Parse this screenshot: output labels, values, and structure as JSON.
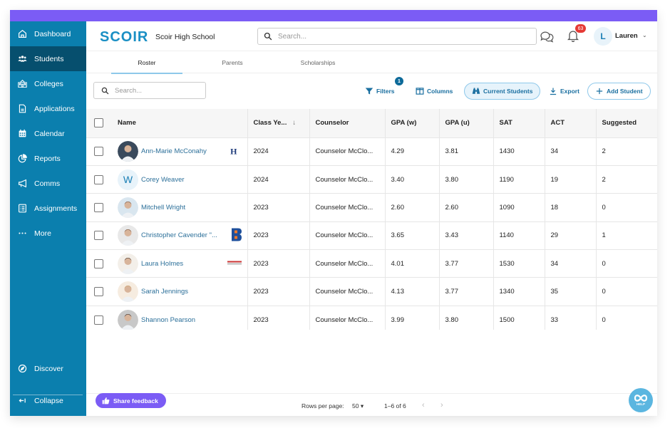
{
  "app": {
    "logo": "SCOIR",
    "school": "Scoir High School"
  },
  "colors": {
    "accent": "#7b5cf5",
    "sidebar": "#0b7fae",
    "sidebar_active": "#064f6e",
    "link": "#2b6f99",
    "notification": "#e53935"
  },
  "header": {
    "search_placeholder": "Search...",
    "notifications_count": "63",
    "user_initial": "L",
    "user_name": "Lauren",
    "user_chevron": "⌄"
  },
  "sidebar": {
    "items": [
      {
        "label": "Dashboard",
        "icon": "home-icon"
      },
      {
        "label": "Students",
        "icon": "users-icon",
        "active": true
      },
      {
        "label": "Colleges",
        "icon": "college-icon"
      },
      {
        "label": "Applications",
        "icon": "document-icon"
      },
      {
        "label": "Calendar",
        "icon": "calendar-icon"
      },
      {
        "label": "Reports",
        "icon": "pie-chart-icon"
      },
      {
        "label": "Comms",
        "icon": "megaphone-icon"
      },
      {
        "label": "Assignments",
        "icon": "list-icon"
      },
      {
        "label": "More",
        "icon": "more-icon"
      }
    ],
    "discover": "Discover",
    "collapse": "Collapse"
  },
  "tabs": [
    {
      "label": "Roster",
      "active": true
    },
    {
      "label": "Parents"
    },
    {
      "label": "Scholarships"
    }
  ],
  "toolbar": {
    "search_placeholder": "Search...",
    "filters": "Filters",
    "filters_count": "1",
    "columns": "Columns",
    "current_students": "Current Students",
    "export": "Export",
    "add_student": "Add Student"
  },
  "table": {
    "columns": [
      "Name",
      "Class Ye...",
      "Counselor",
      "GPA (w)",
      "GPA (u)",
      "SAT",
      "ACT",
      "Suggested"
    ],
    "sort_indicator": "↓",
    "rows": [
      {
        "name": "Ann-Marie McConahy",
        "avatar": "photo",
        "college_logo": "H",
        "class_year": "2024",
        "counselor": "Counselor McClo...",
        "gpa_w": "4.29",
        "gpa_u": "3.81",
        "sat": "1430",
        "act": "34",
        "suggested": "2"
      },
      {
        "name": "Corey Weaver",
        "avatar": "initial",
        "initial": "W",
        "college_logo": "",
        "class_year": "2024",
        "counselor": "Counselor McClo...",
        "gpa_w": "3.40",
        "gpa_u": "3.80",
        "sat": "1190",
        "act": "19",
        "suggested": "2"
      },
      {
        "name": "Mitchell Wright",
        "avatar": "photo",
        "college_logo": "",
        "class_year": "2023",
        "counselor": "Counselor McClo...",
        "gpa_w": "2.60",
        "gpa_u": "2.60",
        "sat": "1090",
        "act": "18",
        "suggested": "0"
      },
      {
        "name": "Christopher Cavender \"...",
        "avatar": "photo",
        "college_logo": "B",
        "class_year": "2023",
        "counselor": "Counselor McClo...",
        "gpa_w": "3.65",
        "gpa_u": "3.43",
        "sat": "1140",
        "act": "29",
        "suggested": "1"
      },
      {
        "name": "Laura Holmes",
        "avatar": "photo",
        "college_logo": "banner",
        "class_year": "2023",
        "counselor": "Counselor McClo...",
        "gpa_w": "4.01",
        "gpa_u": "3.77",
        "sat": "1530",
        "act": "34",
        "suggested": "0"
      },
      {
        "name": "Sarah Jennings",
        "avatar": "photo",
        "college_logo": "",
        "class_year": "2023",
        "counselor": "Counselor McClo...",
        "gpa_w": "4.13",
        "gpa_u": "3.77",
        "sat": "1340",
        "act": "35",
        "suggested": "0"
      },
      {
        "name": "Shannon Pearson",
        "avatar": "photo",
        "college_logo": "",
        "class_year": "2023",
        "counselor": "Counselor McClo...",
        "gpa_w": "3.99",
        "gpa_u": "3.80",
        "sat": "1500",
        "act": "33",
        "suggested": "0"
      }
    ]
  },
  "footer": {
    "feedback": "Share feedback",
    "rows_per_page_label": "Rows per page:",
    "rows_per_page_value": "50 ▾",
    "range": "1–6 of 6",
    "prev": "‹",
    "next": "›",
    "help": "HELP"
  }
}
